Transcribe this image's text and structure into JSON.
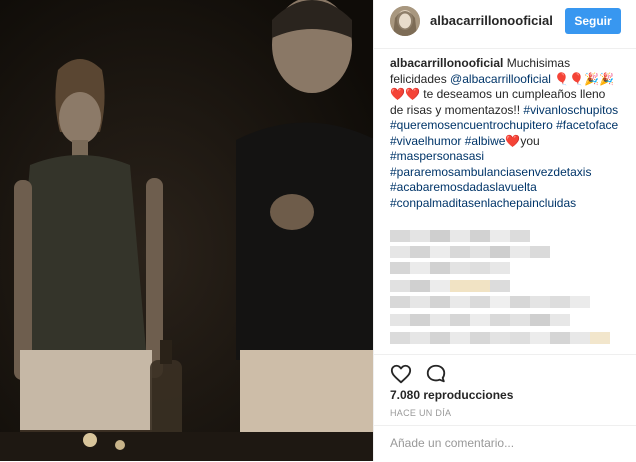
{
  "post": {
    "username": "albacarrillonooficial",
    "follow_label": "Seguir"
  },
  "caption": {
    "user": "albacarrillonooficial",
    "line1": "Muchisimas felicidades",
    "mention": "@albacarrillooficial",
    "emojis": "🎈🎈🎉🎉❤️❤️",
    "text": "te deseamos un cumpleaños lleno de risas y momentazos!!",
    "tag_vivan": "#vivanloschupitos",
    "tag_queremos": "#queremosencuentrochupitero",
    "tag_facetoface": "#facetoface",
    "tag_vivaelhumor": "#vivaelhumor",
    "tag_albiwe": "#albiwe",
    "heart": "❤️",
    "you": "you",
    "tag_maspersonas": "#maspersonasasi",
    "tag_pararemos": "#pararemosambulanciasenvezdetaxis",
    "tag_acabaremos": "#acabaremosdadaslavuelta",
    "tag_conpalmaditas": "#conpalmaditasenlachepaincluidas"
  },
  "stats": {
    "views": "7.080 reproducciones",
    "time": "HACE UN DÍA"
  },
  "comment": {
    "placeholder": "Añade un comentario..."
  },
  "icons": {
    "like": "heart-icon",
    "comment": "comment-icon"
  },
  "colors": {
    "follow_button": "#3897f0",
    "hashtag": "#003569",
    "secondary_text": "#999999"
  }
}
